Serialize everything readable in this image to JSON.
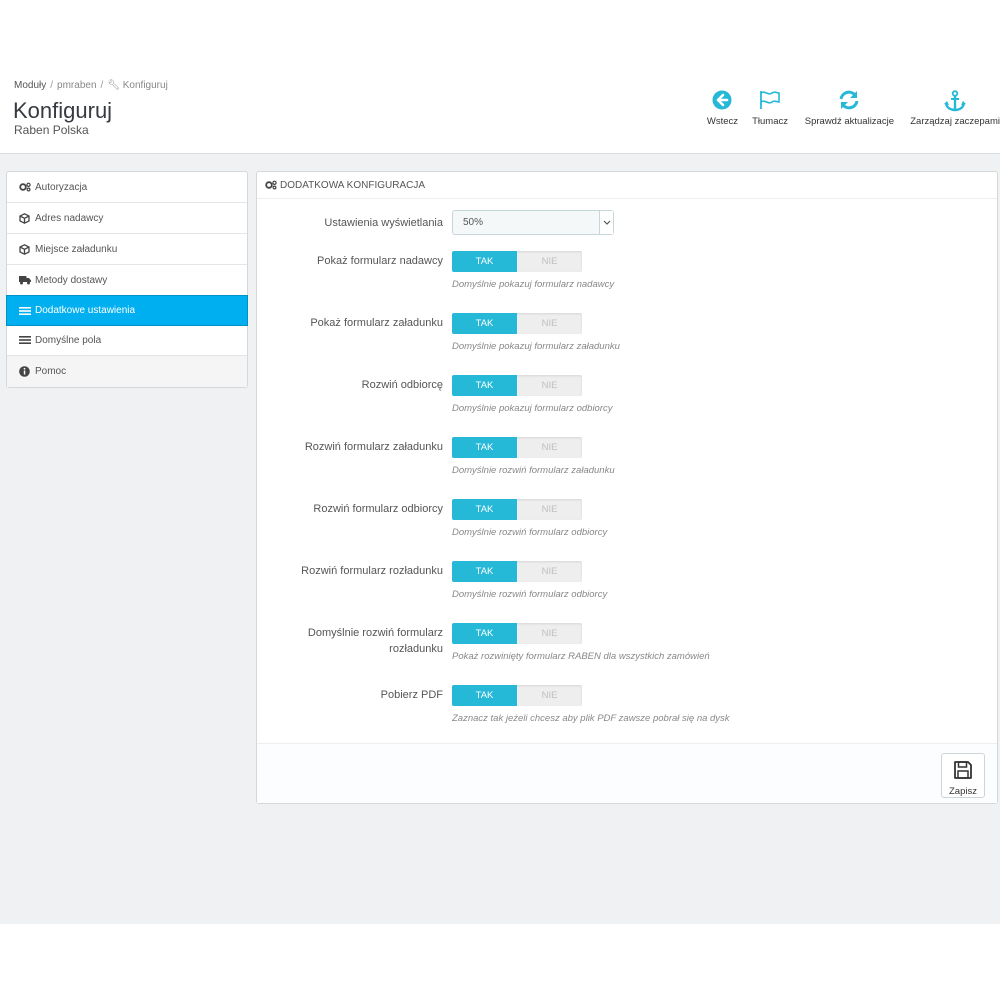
{
  "breadcrumb": {
    "item1": "Moduły",
    "item2": "pmraben",
    "item3": "Konfiguruj"
  },
  "page": {
    "title": "Konfiguruj",
    "subtitle": "Raben Polska"
  },
  "toolbar": {
    "back": "Wstecz",
    "translate": "Tłumacz",
    "check_updates": "Sprawdź aktualizacje",
    "manage_hooks": "Zarządzaj zaczepami"
  },
  "sidebar": {
    "items": [
      {
        "label": "Autoryzacja",
        "icon": "cogs-icon"
      },
      {
        "label": "Adres nadawcy",
        "icon": "cube-icon"
      },
      {
        "label": "Miejsce załadunku",
        "icon": "cube-icon"
      },
      {
        "label": "Metody dostawy",
        "icon": "truck-icon"
      },
      {
        "label": "Dodatkowe ustawienia",
        "icon": "list-icon",
        "active": true
      },
      {
        "label": "Domyślne pola",
        "icon": "list-icon"
      },
      {
        "label": "Pomoc",
        "icon": "info-icon"
      }
    ]
  },
  "panel": {
    "heading": "DODATKOWA KONFIGURACJA",
    "display_setting": {
      "label": "Ustawienia wyświetlania",
      "value": "50%"
    },
    "switches": [
      {
        "label": "Pokaż formularz nadawcy",
        "yes": "TAK",
        "no": "NIE",
        "help": "Domyślnie pokazuj formularz nadawcy"
      },
      {
        "label": "Pokaż formularz załadunku",
        "yes": "TAK",
        "no": "NIE",
        "help": "Domyślnie pokazuj formularz załadunku"
      },
      {
        "label": "Rozwiń odbiorcę",
        "yes": "TAK",
        "no": "NIE",
        "help": "Domyślnie pokazuj formularz odbiorcy"
      },
      {
        "label": "Rozwiń formularz załadunku",
        "yes": "TAK",
        "no": "NIE",
        "help": "Domyślnie rozwiń formularz załadunku"
      },
      {
        "label": "Rozwiń formularz odbiorcy",
        "yes": "TAK",
        "no": "NIE",
        "help": "Domyślnie rozwiń formularz odbiorcy"
      },
      {
        "label": "Rozwiń formularz rozładunku",
        "yes": "TAK",
        "no": "NIE",
        "help": "Domyślnie rozwiń formularz odbiorcy"
      },
      {
        "label_line1": "Domyślnie rozwiń formularz",
        "label_line2": "rozładunku",
        "yes": "TAK",
        "no": "NIE",
        "help": "Pokaż rozwinięty formularz RABEN dla wszystkich zamówień"
      },
      {
        "label": "Pobierz PDF",
        "yes": "TAK",
        "no": "NIE",
        "help": "Zaznacz tak jeżeli chcesz aby plik PDF zawsze pobrał się na dysk"
      }
    ],
    "save": "Zapisz"
  },
  "colors": {
    "accent": "#25b9d7",
    "active_nav": "#00aff0",
    "background": "#eff1f2"
  }
}
